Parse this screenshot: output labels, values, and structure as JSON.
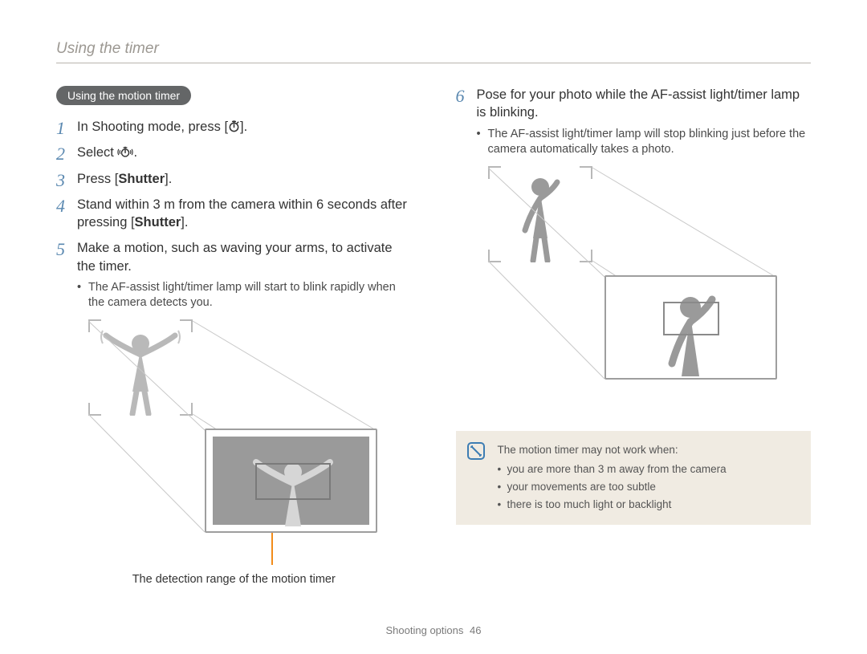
{
  "page_title": "Using the timer",
  "section_heading": "Using the motion timer",
  "left_steps": [
    {
      "parts": [
        {
          "t": "In Shooting mode, press ["
        },
        {
          "icon": "timer-icon"
        },
        {
          "t": "]."
        }
      ]
    },
    {
      "parts": [
        {
          "t": "Select "
        },
        {
          "icon": "motion-timer-icon"
        },
        {
          "t": "."
        }
      ]
    },
    {
      "parts": [
        {
          "t": "Press ["
        },
        {
          "b": "Shutter"
        },
        {
          "t": "]."
        }
      ]
    },
    {
      "parts": [
        {
          "t": "Stand within 3 m from the camera within 6 seconds after pressing ["
        },
        {
          "b": "Shutter"
        },
        {
          "t": "]."
        }
      ]
    },
    {
      "parts": [
        {
          "t": "Make a motion, such as waving your arms, to activate the timer."
        }
      ],
      "bullets": [
        "The AF-assist light/timer lamp will start to blink rapidly when the camera detects you."
      ]
    }
  ],
  "left_caption": "The detection range of the motion timer",
  "right_step_start": 6,
  "right_steps": [
    {
      "parts": [
        {
          "t": "Pose for your photo while the AF-assist light/timer lamp is blinking."
        }
      ],
      "bullets": [
        "The AF-assist light/timer lamp will stop blinking just before the camera automatically takes a photo."
      ]
    }
  ],
  "note": {
    "lead": "The motion timer may not work when:",
    "items": [
      "you are more than 3 m away from the camera",
      "your movements are too subtle",
      "there is too much light or backlight"
    ]
  },
  "footer_section": "Shooting options",
  "footer_page": "46"
}
